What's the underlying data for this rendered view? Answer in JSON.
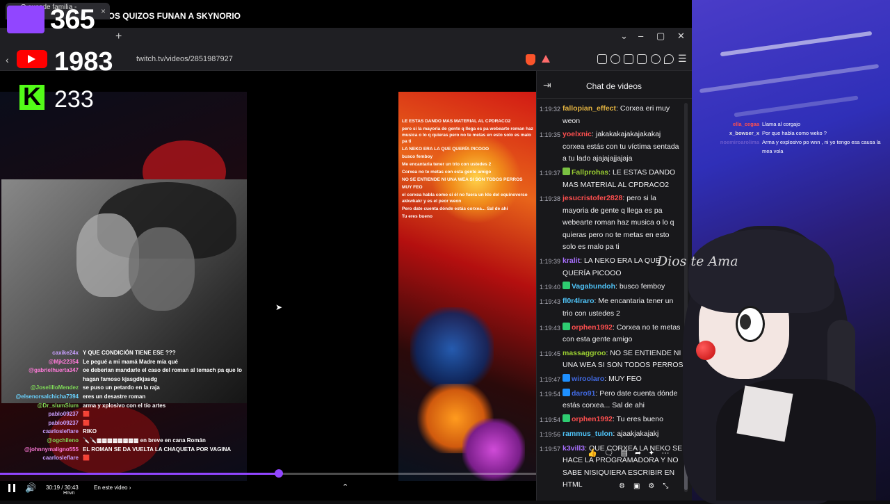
{
  "stream_title": "CORXEA Y LA LIMA DE LOS QUIZOS FUNAN A SKYNORIO",
  "browser": {
    "tab_title": "Q sucede familia - Twitch",
    "url": "twitch.tv/videos/2851987927"
  },
  "overlay_stats": {
    "twitch_count": "365",
    "youtube_count": "1983",
    "kick_count": "233",
    "kick_letter": "K"
  },
  "embedded_chat": [
    "LE ESTAS DANDO MAS MATERIAL AL CPDRACO2",
    "pero si la mayoria de gente q llega es pa webearte roman haz musica o lo q quieras pero no te metas en esto solo es malo pa ti",
    "LA NEKO ERA LA QUE QUERÍA PICOOO",
    "busco femboy",
    "Me encantaria tener un trio con ustedes 2",
    "Corxea no te metas con esta gente amigo",
    "NO SE ENTIENDE NI UNA WEA SI SON TODOS PERROS",
    "MUY FEO",
    "el corxea habla como si él no fuera un klo del equinoverso akkwkakr y es el peor weon",
    "Pero date cuenta dónde estás corxea... Sal de ahi",
    "Tu eres bueno"
  ],
  "overlay_chat": [
    {
      "user": "caxike24x",
      "msg": "Y QUE CONDICIÓN TIENE ESE ???",
      "color": "#c9a0ff"
    },
    {
      "user": "@Mjk22354",
      "msg": "Le pegué a mi mamá Madre mía qué",
      "color": "#ff7ad9"
    },
    {
      "user": "@gabrielhuerta347",
      "msg": "oe deberian mandarle el caso del roman al temach pa que lo hagan famoso kjasgdkjasdg",
      "color": "#ff7ad9"
    },
    {
      "user": "@JoselilloMendez",
      "msg": "se puso un petardo en la raja",
      "color": "#7ed957"
    },
    {
      "user": "@elsenorsalchicha7394",
      "msg": "eres un desastre roman",
      "color": "#6ad3ff"
    },
    {
      "user": "@Dr_slumSlum",
      "msg": "arma y xplosivo con el tío artes",
      "color": "#7ed957"
    },
    {
      "user": "pablo09237",
      "msg": "🟥",
      "color": "#c9a0ff"
    },
    {
      "user": "pablo09237",
      "msg": "🟥",
      "color": "#c9a0ff"
    },
    {
      "user": "caarlosleflare",
      "msg": "RIKO",
      "color": "#c9a0ff"
    },
    {
      "user": "@ogchileno",
      "msg": "🔪🔪▩▩▩▩▩▩▩▩ en breve en cana Román",
      "color": "#7ed957"
    },
    {
      "user": "@johnnymaligno555",
      "msg": "EL ROMAN SE DA VUELTA LA CHAQUETA POR VAGINA",
      "color": "#ff7ad9"
    },
    {
      "user": "caarlosleflare",
      "msg": "🟥",
      "color": "#c9a0ff"
    }
  ],
  "player": {
    "time": "30:19 / 30:43",
    "stream_name": "Hnvn",
    "section_label": "En este video",
    "progress": 0.52
  },
  "chat": {
    "title": "Chat de videos",
    "messages": [
      {
        "ts": "1:19:32",
        "user": "fallopian_effect",
        "color": "#e3b341",
        "msg": "Corxea eri muy weon"
      },
      {
        "ts": "1:19:35",
        "user": "yoelxnic",
        "color": "#ff4f4f",
        "msg": "jakakakajakajakakaj corxea estás con tu víctima sentada a tu lado ajajajajjajaja"
      },
      {
        "ts": "1:19:37",
        "user": "Fallprohas",
        "color": "#9acd32",
        "msg": "LE ESTAS DANDO MAS MATERIAL AL CPDRACO2",
        "badge": "#7ac142"
      },
      {
        "ts": "1:19:38",
        "user": "jesucristofer2828",
        "color": "#ff4f4f",
        "msg": "pero si la mayoria de gente q llega es pa webearte roman haz musica o lo q quieras pero no te metas en esto solo es malo pa ti"
      },
      {
        "ts": "1:19:39",
        "user": "kralit",
        "color": "#a970ff",
        "msg": "LA NEKO ERA LA QUE QUERÍA PICOOO"
      },
      {
        "ts": "1:19:40",
        "user": "Vagabundoh",
        "color": "#4fc3f7",
        "msg": "busco femboy",
        "badge": "#2ecc71"
      },
      {
        "ts": "1:19:43",
        "user": "fl0r4lraro",
        "color": "#4fc3f7",
        "msg": "Me encantaria tener un trio con ustedes 2"
      },
      {
        "ts": "1:19:43",
        "user": "orphen1992",
        "color": "#ff4f4f",
        "msg": "Corxea no te metas con esta gente amigo",
        "badge": "#2ecc71"
      },
      {
        "ts": "1:19:45",
        "user": "massaggroo",
        "color": "#9acd32",
        "msg": "NO SE ENTIENDE NI UNA WEA SI SON TODOS PERROS"
      },
      {
        "ts": "1:19:47",
        "user": "wiroolaro",
        "color": "#4169e1",
        "msg": "MUY FEO",
        "badge": "#1e90ff"
      },
      {
        "ts": "1:19:54",
        "user": "daro91",
        "color": "#4169e1",
        "msg": "Pero date cuenta dónde estás corxea... Sal de ahi",
        "badge": "#1e90ff"
      },
      {
        "ts": "1:19:54",
        "user": "orphen1992",
        "color": "#ff4f4f",
        "msg": "Tu eres bueno",
        "badge": "#2ecc71"
      },
      {
        "ts": "1:19:56",
        "user": "rammus_tulon",
        "color": "#4fc3f7",
        "msg": "ajaakjakajakj"
      },
      {
        "ts": "1:19:57",
        "user": "k3vill3",
        "color": "#a970ff",
        "msg": "QUE CORXEA LA NEKO SE HACE LA PROGRAMADORA Y NO SABE NISIQUIERA ESCRIBIR EN HTML"
      }
    ]
  },
  "side_chat": [
    {
      "user": "ella_cegaa",
      "color": "#ff4f4f",
      "msg": "Llama al corgajo"
    },
    {
      "user": "x_bowser_x",
      "color": "#e3e3e3",
      "msg": "Por que habla como weko ?"
    },
    {
      "user": "noemiroarolima",
      "color": "#6a5acd",
      "msg": "Arma y explosivo po wnn , ni yo tengo esa causa la mea vola"
    }
  ],
  "signature_text": "Dios te Ama"
}
